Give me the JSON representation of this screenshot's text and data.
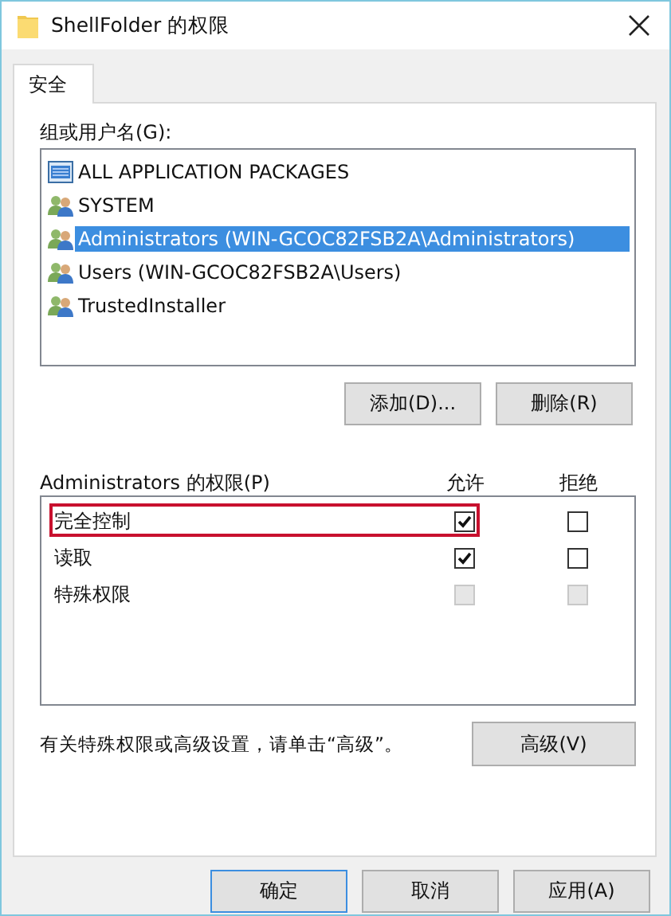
{
  "window": {
    "title": "ShellFolder 的权限"
  },
  "tabs": [
    {
      "label": "安全",
      "selected": true
    }
  ],
  "groups": {
    "label": "组或用户名(G):",
    "items": [
      {
        "name": "ALL APPLICATION PACKAGES",
        "kind": "package",
        "selected": false
      },
      {
        "name": "SYSTEM",
        "kind": "users",
        "selected": false
      },
      {
        "name": "Administrators (WIN-GCOC82FSB2A\\Administrators)",
        "kind": "users",
        "selected": true
      },
      {
        "name": "Users (WIN-GCOC82FSB2A\\Users)",
        "kind": "users",
        "selected": false
      },
      {
        "name": "TrustedInstaller",
        "kind": "users",
        "selected": false
      }
    ]
  },
  "group_buttons": [
    "添加(D)...",
    "删除(R)"
  ],
  "permissions": {
    "label": "Administrators 的权限(P)",
    "allow_header": "允许",
    "deny_header": "拒绝",
    "rows": [
      {
        "name": "完全控制",
        "highlighted": true,
        "allow": {
          "checked": true,
          "disabled": false
        },
        "deny": {
          "checked": false,
          "disabled": false
        }
      },
      {
        "name": "读取",
        "highlighted": false,
        "allow": {
          "checked": true,
          "disabled": false
        },
        "deny": {
          "checked": false,
          "disabled": false
        }
      },
      {
        "name": "特殊权限",
        "highlighted": false,
        "allow": {
          "checked": false,
          "disabled": true
        },
        "deny": {
          "checked": false,
          "disabled": true
        }
      }
    ]
  },
  "advanced": {
    "note": "有关特殊权限或高级设置，请单击“高级”。",
    "button": "高级(V)"
  },
  "footer_buttons": [
    "确定",
    "取消",
    "应用(A)"
  ]
}
